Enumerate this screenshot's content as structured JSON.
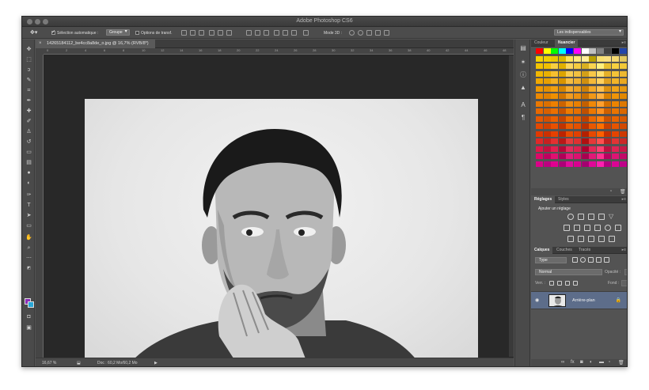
{
  "window": {
    "title": "Adobe Photoshop CS6"
  },
  "options": {
    "auto_select_label": "Sélection automatique :",
    "auto_select_value": "Groupe",
    "transform_label": "Options de transf.",
    "mode3d_label": "Mode 3D :",
    "workspace": "Les indispensables"
  },
  "document": {
    "tab_title": "14265184112_be4cc8a8de_o.jpg @ 16,7% (RVB/8*)",
    "zoom": "16,67 %",
    "doc_info": "Doc : 60,2 Mo/60,2 Mo",
    "ruler_ticks": [
      "0",
      "2",
      "4",
      "6",
      "8",
      "10",
      "12",
      "14",
      "16",
      "18",
      "20",
      "22",
      "24",
      "26",
      "28",
      "30",
      "32",
      "34",
      "36",
      "38",
      "40",
      "42",
      "44",
      "46",
      "48"
    ]
  },
  "panels": {
    "color_tab": "Couleur",
    "swatches_tab": "Nuancier",
    "adjust_tab": "Réglages",
    "styles_tab": "Styles",
    "add_adjust": "Ajouter un réglage",
    "layers_tab": "Calques",
    "channels_tab": "Couches",
    "paths_tab": "Tracés",
    "filter_kind": "Type",
    "blend_mode": "Normal",
    "opacity_label": "Opacité :",
    "opacity_value": "100 %",
    "lock_label": "Verr. :",
    "fill_label": "Fond :",
    "fill_value": "100 %",
    "layer_name": "Arrière-plan"
  },
  "colors": {
    "foreground": "#8a2db6",
    "background": "#2aa8d8"
  }
}
